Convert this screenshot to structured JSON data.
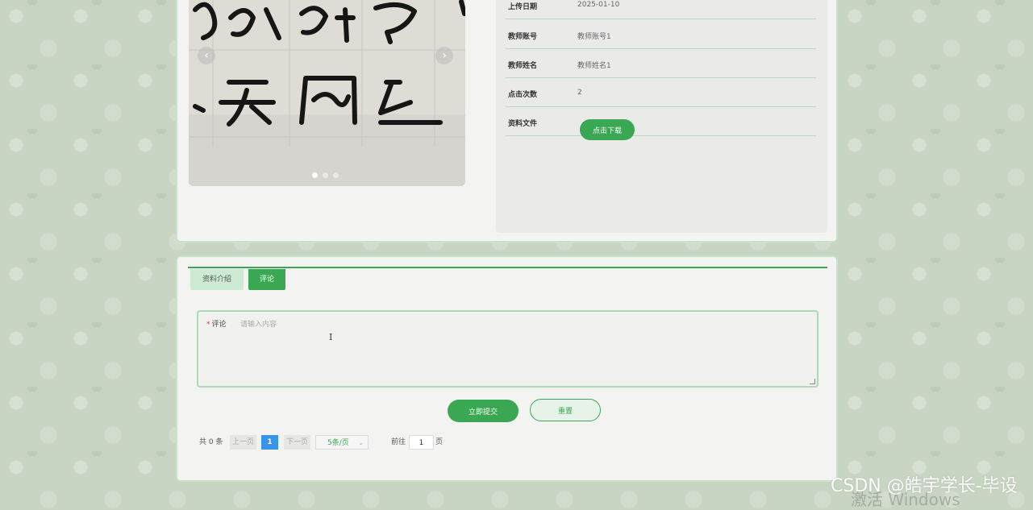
{
  "info": {
    "rows": [
      {
        "label": "上传日期",
        "value": "2025-01-10"
      },
      {
        "label": "教师账号",
        "value": "教师账号1"
      },
      {
        "label": "教师姓名",
        "value": "教师姓名1"
      },
      {
        "label": "点击次数",
        "value": "2"
      },
      {
        "label": "资料文件",
        "value": ""
      }
    ],
    "download_label": "点击下载"
  },
  "carousel": {
    "prev_icon": "chevron-left-icon",
    "next_icon": "chevron-right-icon",
    "prev_glyph": "‹",
    "next_glyph": "›",
    "slide_count": 3,
    "active_slide": 1
  },
  "tabs": [
    {
      "label": "资料介绍",
      "active": false
    },
    {
      "label": "评论",
      "active": true
    }
  ],
  "comment": {
    "label": "评论",
    "required_mark": "*",
    "placeholder": "请输入内容",
    "value": ""
  },
  "buttons": {
    "submit_label": "立即提交",
    "reset_label": "重置"
  },
  "pagination": {
    "total": "共 0 条",
    "prev": "上一页",
    "current": "1",
    "next": "下一页",
    "page_size": "5条/页",
    "goto_label": "前往",
    "goto_value": "1",
    "unit": "页"
  },
  "watermark": {
    "text": "CSDN @皓宇学长-毕设",
    "windows": "激活 Windows"
  },
  "colors": {
    "accent": "#3aa852",
    "page_active": "#3a94e8"
  }
}
